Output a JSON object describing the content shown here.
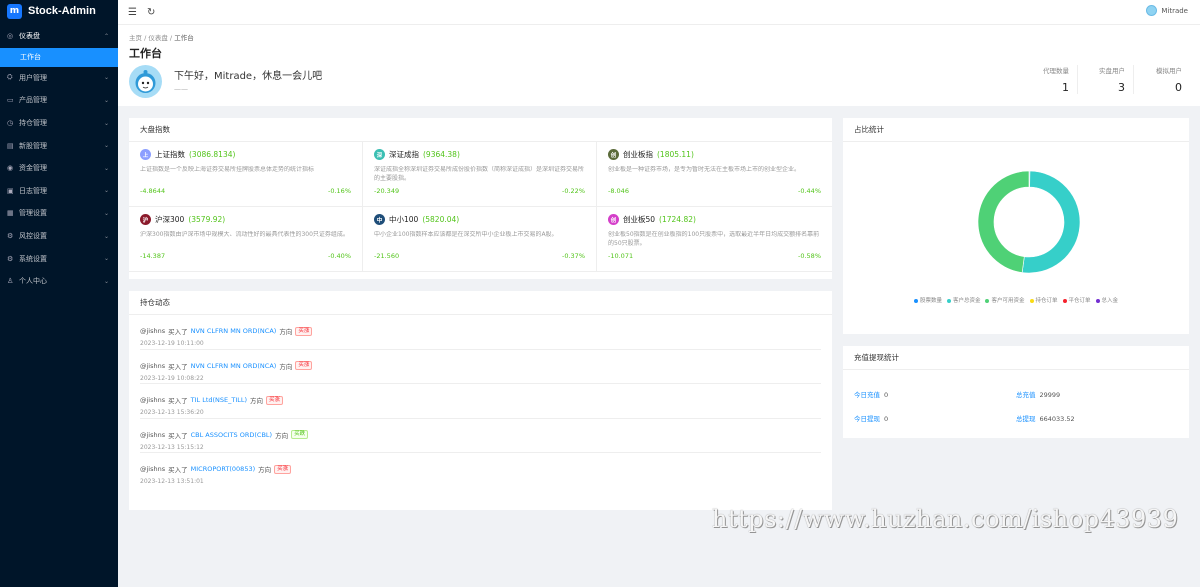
{
  "brand": {
    "name": "Stock-Admin",
    "logo_text": "m"
  },
  "sidebar": {
    "items": [
      {
        "label": "仪表盘",
        "icon": "dashboard-icon",
        "glyph": "◎",
        "chevron": "⌃",
        "state": "open"
      },
      {
        "label": "工作台",
        "icon": "",
        "glyph": "",
        "chevron": "",
        "state": "active"
      },
      {
        "label": "用户管理",
        "icon": "users-icon",
        "glyph": "⛭",
        "chevron": "⌄",
        "state": ""
      },
      {
        "label": "产品管理",
        "icon": "product-icon",
        "glyph": "▭",
        "chevron": "⌄",
        "state": ""
      },
      {
        "label": "持仓管理",
        "icon": "position-icon",
        "glyph": "◷",
        "chevron": "⌄",
        "state": ""
      },
      {
        "label": "新股管理",
        "icon": "ipo-icon",
        "glyph": "▤",
        "chevron": "⌄",
        "state": ""
      },
      {
        "label": "资金管理",
        "icon": "fund-icon",
        "glyph": "◉",
        "chevron": "⌄",
        "state": ""
      },
      {
        "label": "日志管理",
        "icon": "log-icon",
        "glyph": "▣",
        "chevron": "⌄",
        "state": ""
      },
      {
        "label": "管理设置",
        "icon": "admin-settings-icon",
        "glyph": "▦",
        "chevron": "⌄",
        "state": ""
      },
      {
        "label": "风控设置",
        "icon": "risk-icon",
        "glyph": "⚙",
        "chevron": "⌄",
        "state": ""
      },
      {
        "label": "系统设置",
        "icon": "system-settings-icon",
        "glyph": "⚙",
        "chevron": "⌄",
        "state": ""
      },
      {
        "label": "个人中心",
        "icon": "person-icon",
        "glyph": "♙",
        "chevron": "⌄",
        "state": ""
      }
    ]
  },
  "topbar": {
    "user_name": "Mitrade"
  },
  "breadcrumb": [
    "主页",
    "仪表盘",
    "工作台"
  ],
  "page": {
    "title": "工作台",
    "greeting": "下午好，Mitrade，休息一会儿吧",
    "greeting_sub": "——"
  },
  "stats": [
    {
      "label": "代理数量",
      "value": "1"
    },
    {
      "label": "实盘用户",
      "value": "3"
    },
    {
      "label": "模拟用户",
      "value": "0"
    }
  ],
  "market": {
    "title": "大盘指数",
    "indices": [
      {
        "name": "上证指数",
        "value": "(3086.8134)",
        "icon_text": "上",
        "color": "#8c9eff",
        "desc": "上证指数是一个反映上海证券交易所挂牌股票总体走势的统计指标",
        "change": "-4.8644",
        "percent": "-0.16%"
      },
      {
        "name": "深证成指",
        "value": "(9364.38)",
        "icon_text": "深",
        "color": "#3bbfb3",
        "desc": "深证成指全称深圳证券交易所成份股价指数（简称深证成指）是深圳证券交易所的主要股指。",
        "change": "-20.349",
        "percent": "-0.22%"
      },
      {
        "name": "创业板指",
        "value": "(1805.11)",
        "icon_text": "创",
        "color": "#5b6b3a",
        "desc": "创业板是一种证券市场，是专为暂时无法在主板市场上市的创业型企业。",
        "change": "-8.046",
        "percent": "-0.44%"
      },
      {
        "name": "沪深300",
        "value": "(3579.92)",
        "icon_text": "沪",
        "color": "#8b1a2b",
        "desc": "沪深300指数由沪深市场中规模大、流动性好的最具代表性的300只证券组成。",
        "change": "-14.387",
        "percent": "-0.40%"
      },
      {
        "name": "中小100",
        "value": "(5820.04)",
        "icon_text": "中",
        "color": "#1f4e79",
        "desc": "中小企业100指数样本应该都是在深交所中小企业板上市交易的A股。",
        "change": "-21.560",
        "percent": "-0.37%"
      },
      {
        "name": "创业板50",
        "value": "(1724.82)",
        "icon_text": "创",
        "color": "#d43fc9",
        "desc": "创业板50指数是在创业板指的100只股票中，选取最近半年日均成交额排名靠前的50只股票。",
        "change": "-10.071",
        "percent": "-0.58%"
      }
    ]
  },
  "activity": {
    "title": "持仓动态",
    "items": [
      {
        "user": "@jishns",
        "action": "买入了",
        "stock": "NVN CLFRN MN ORD(NCA)",
        "direction_label": "方向",
        "tag": "买涨",
        "tag_type": "buy",
        "time": "2023-12-19 10:11:00"
      },
      {
        "user": "@jishns",
        "action": "买入了",
        "stock": "NVN CLFRN MN ORD(NCA)",
        "direction_label": "方向",
        "tag": "买涨",
        "tag_type": "buy",
        "time": "2023-12-19 10:08:22"
      },
      {
        "user": "@jishns",
        "action": "买入了",
        "stock": "TIL Ltd(NSE_TILL)",
        "direction_label": "方向",
        "tag": "买涨",
        "tag_type": "buy",
        "time": "2023-12-13 15:36:20"
      },
      {
        "user": "@jishns",
        "action": "买入了",
        "stock": "CBL ASSOCITS ORD(CBL)",
        "direction_label": "方向",
        "tag": "买跌",
        "tag_type": "sell",
        "time": "2023-12-13 15:15:12"
      },
      {
        "user": "@jishns",
        "action": "买入了",
        "stock": "MICROPORT(00853)",
        "direction_label": "方向",
        "tag": "买涨",
        "tag_type": "buy",
        "time": "2023-12-13 13:51:01"
      }
    ]
  },
  "ratio": {
    "title": "占比统计",
    "legend": [
      {
        "label": "股票数量",
        "color": "#1890ff"
      },
      {
        "label": "客户总资金",
        "color": "#36cfc9"
      },
      {
        "label": "客户可用资金",
        "color": "#4fd176"
      },
      {
        "label": "持仓订单",
        "color": "#fadb14"
      },
      {
        "label": "平仓订单",
        "color": "#f5222d"
      },
      {
        "label": "总入金",
        "color": "#722ed1"
      }
    ],
    "chart_data": {
      "type": "pie",
      "style": "donut",
      "labels": [
        "股票数量",
        "客户总资金",
        "客户可用资金",
        "持仓订单",
        "平仓订单",
        "总入金"
      ],
      "values": [
        0.3,
        52,
        48,
        0,
        0,
        0
      ]
    }
  },
  "funds": {
    "title": "充值提现统计",
    "items": [
      {
        "label": "今日充值",
        "value": "0"
      },
      {
        "label": "总充值",
        "value": "29999"
      },
      {
        "label": "今日提现",
        "value": "0"
      },
      {
        "label": "总提现",
        "value": "664033.52"
      }
    ]
  },
  "watermark": "https://www.huzhan.com/ishop43939"
}
